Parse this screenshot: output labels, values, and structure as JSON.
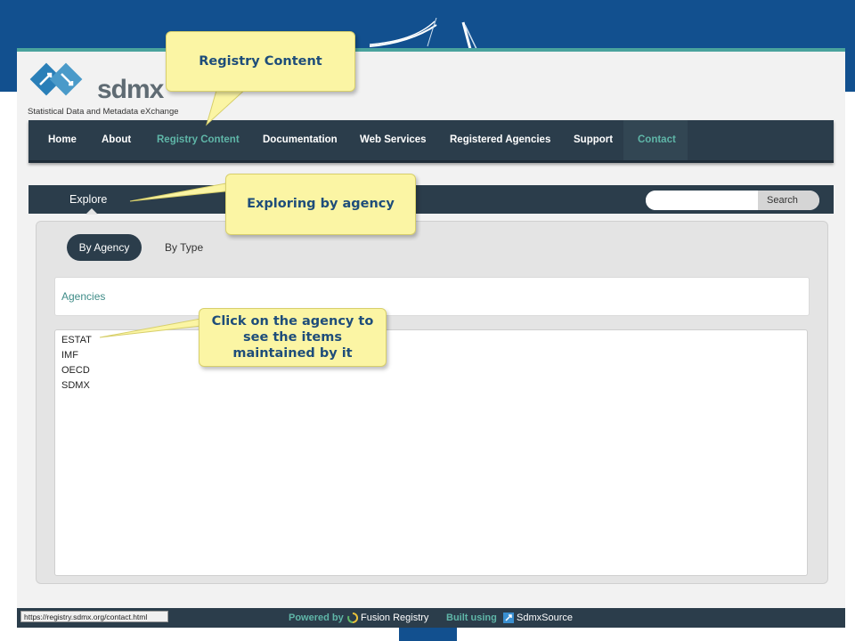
{
  "callouts": {
    "registry_content": "Registry Content",
    "exploring_by_agency": "Exploring by agency",
    "click_agency": "Click on the agency to see the items maintained by it"
  },
  "logo": {
    "text": "sdmx",
    "subtitle": "Statistical Data and Metadata eXchange"
  },
  "nav": {
    "items": [
      {
        "label": "Home"
      },
      {
        "label": "About"
      },
      {
        "label": "Registry Content",
        "active": true
      },
      {
        "label": "Documentation"
      },
      {
        "label": "Web Services"
      },
      {
        "label": "Registered Agencies"
      },
      {
        "label": "Support"
      },
      {
        "label": "Contact",
        "active": true
      }
    ]
  },
  "explore": {
    "tab_label": "Explore",
    "search_placeholder": "",
    "search_button": "Search"
  },
  "filter": {
    "by_agency": "By Agency",
    "by_type": "By Type",
    "selected": "By Agency"
  },
  "agencies": {
    "title": "Agencies",
    "items": [
      "ESTAT",
      "IMF",
      "OECD",
      "SDMX"
    ]
  },
  "footer": {
    "status_url": "https://registry.sdmx.org/contact.html",
    "powered_by": "Powered by",
    "fusion_registry": "Fusion Registry",
    "built_using": "Built using",
    "sdmx_source": "SdmxSource"
  },
  "colors": {
    "brand_blue": "#12508f",
    "nav_dark": "#2b3d4b",
    "accent_teal": "#5fb6a8",
    "callout_yellow": "#fbf5a4"
  }
}
